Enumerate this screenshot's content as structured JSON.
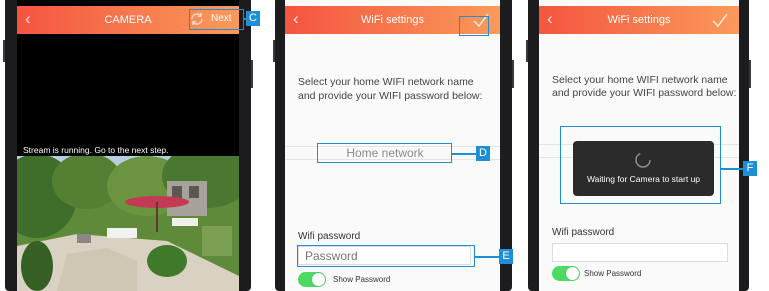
{
  "camera_screen": {
    "title": "CAMERA",
    "next_label": "Next",
    "stream_status": "Stream is running. Go to the next step.",
    "callout": "C"
  },
  "wifi_screen_1": {
    "title": "WiFi settings",
    "instructions_line1": "Select your home WIFI network name",
    "instructions_line2": "and provide your WIFI password below:",
    "network_placeholder": "Home network",
    "password_label": "Wifi password",
    "password_placeholder": "Password",
    "show_password_label": "Show Password",
    "callout_network": "D",
    "callout_password": "E"
  },
  "wifi_screen_2": {
    "title": "WiFi settings",
    "instructions_line1": "Select your home WIFI network name",
    "instructions_line2": "and provide your WIFI password below:",
    "waiting_text": "Waiting for Camera to start up",
    "password_label": "Wifi password",
    "show_password_label": "Show Password",
    "callout": "F"
  },
  "icons": [
    "back-chevron-icon",
    "refresh-icon",
    "checkmark-icon",
    "spinner-icon"
  ],
  "colors": {
    "header_start": "#f5553f",
    "header_end": "#fb9a5a",
    "callout_blue": "#1e8fd6",
    "toggle_green": "#4cd964",
    "phone_frame": "#1c1c1e"
  }
}
